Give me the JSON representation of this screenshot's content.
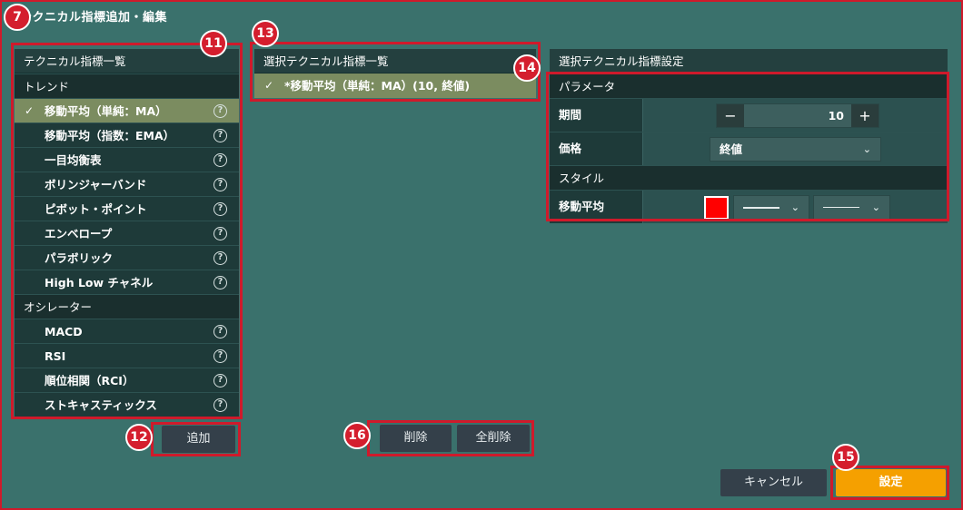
{
  "window": {
    "title": "テクニカル指標追加・編集"
  },
  "callouts": {
    "c7": "7",
    "c11": "11",
    "c12": "12",
    "c13": "13",
    "c14": "14",
    "c15": "15",
    "c16": "16"
  },
  "indicator_list": {
    "header": "テクニカル指標一覧",
    "categories": [
      {
        "label": "トレンド",
        "items": [
          "移動平均（単純：MA）",
          "移動平均（指数：EMA）",
          "一目均衡表",
          "ボリンジャーバンド",
          "ピボット・ポイント",
          "エンベロープ",
          "パラボリック",
          "High Low チャネル"
        ]
      },
      {
        "label": "オシレーター",
        "items": [
          "MACD",
          "RSI",
          "順位相関（RCI）",
          "ストキャスティックス"
        ]
      }
    ],
    "selected_item": "移動平均（単純：MA）",
    "help_icon": "question-circle-icon",
    "check_icon": "✓",
    "help_glyph": "?"
  },
  "buttons": {
    "add": "追加",
    "delete": "削除",
    "delete_all": "全削除",
    "cancel": "キャンセル",
    "ok": "設定"
  },
  "selected_list": {
    "header": "選択テクニカル指標一覧",
    "items": [
      "*移動平均（単純：MA）(10, 終値)"
    ]
  },
  "settings": {
    "header": "選択テクニカル指標設定",
    "params_header": "パラメータ",
    "period_label": "期間",
    "period_value": "10",
    "minus": "−",
    "plus": "+",
    "price_label": "価格",
    "price_value": "終値",
    "style_header": "スタイル",
    "ma_label": "移動平均",
    "line_color": "#ff0000",
    "chev": "⌄"
  },
  "colors": {
    "highlight": "#cf1a2b",
    "primary": "#f5a000",
    "background": "#3a716c"
  }
}
